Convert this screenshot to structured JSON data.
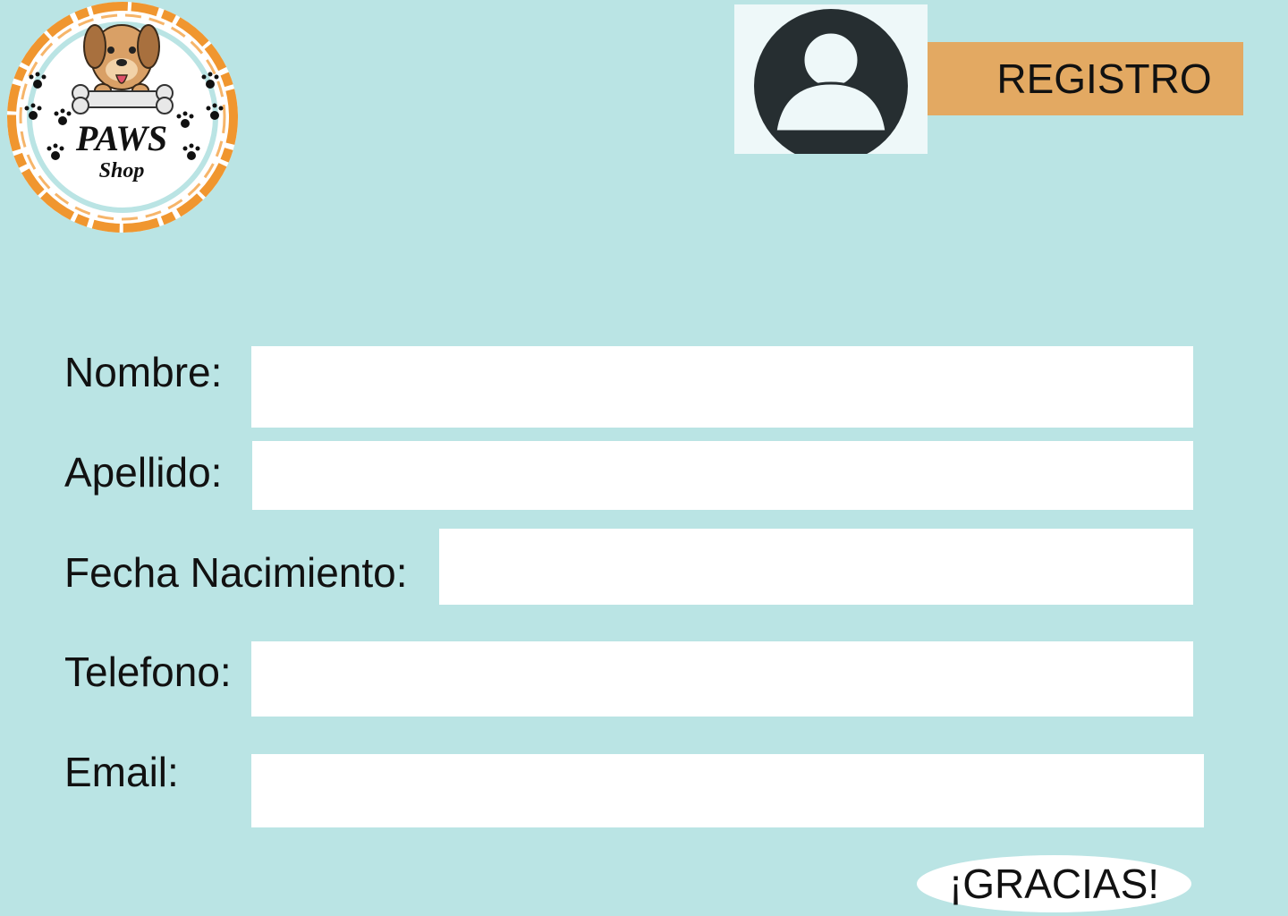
{
  "brand": {
    "name": "PAWS",
    "subtitle": "Shop",
    "accent_color": "#f0962f"
  },
  "header": {
    "avatar_icon": "user-avatar-icon",
    "register_label": "REGISTRO"
  },
  "form": {
    "fields": [
      {
        "label": "Nombre:",
        "value": ""
      },
      {
        "label": "Apellido:",
        "value": ""
      },
      {
        "label": "Fecha Nacimiento:",
        "value": ""
      },
      {
        "label": "Telefono:",
        "value": ""
      },
      {
        "label": "Email:",
        "value": ""
      }
    ],
    "submit_label": "¡GRACIAS!"
  },
  "colors": {
    "background": "#bae4e4",
    "register_button": "#e3a962",
    "input_background": "#ffffff",
    "avatar_dark": "#262e31"
  }
}
